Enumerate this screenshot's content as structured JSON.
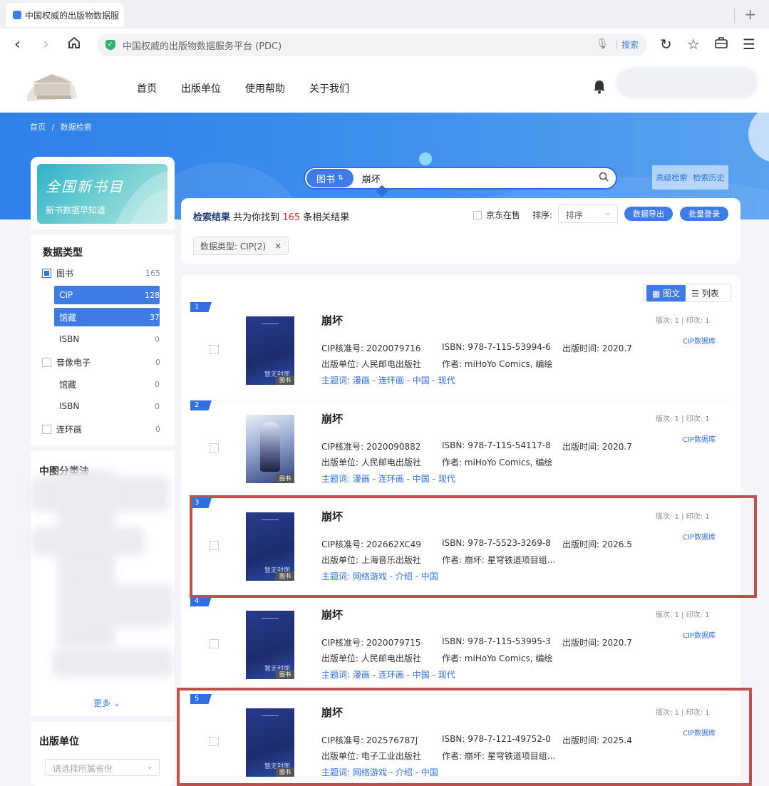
{
  "browser": {
    "tab_title": "中国权威的出版物数据服",
    "address_text": "中国权威的出版物数据服务平台 (PDC)",
    "search_label": "搜索",
    "new_tab": "+"
  },
  "site": {
    "nav": [
      "首页",
      "出版单位",
      "使用帮助",
      "关于我们"
    ]
  },
  "breadcrumb": [
    "首页",
    "/",
    "数据检索"
  ],
  "promo": {
    "title": "全国新书目",
    "subtitle": "新书数据早知道"
  },
  "facets": {
    "title": "数据类型",
    "items": [
      {
        "label": "图书",
        "count": "165"
      },
      {
        "label": "CIP",
        "count": "128"
      },
      {
        "label": "馆藏",
        "count": "37"
      },
      {
        "label": "ISBN",
        "count": "0"
      },
      {
        "label": "音像电子",
        "count": "0"
      },
      {
        "label": "馆藏",
        "count": "0"
      },
      {
        "label": "ISBN",
        "count": "0"
      },
      {
        "label": "连环画",
        "count": "0"
      }
    ],
    "classification_title": "中图分类法",
    "more": "更多",
    "publisher_title": "出版单位",
    "province_placeholder": "请选择所属省份"
  },
  "search": {
    "type": "图书",
    "type_arrow": "⇅",
    "query": "崩坏",
    "advanced": "高级检索",
    "history": "检索历史"
  },
  "results": {
    "title": "检索结果",
    "found_prefix": "共为你找到",
    "found_count": "165",
    "found_suffix": "条相关结果",
    "jd_label": "京东在售",
    "sort_label": "排序:",
    "sort_value": "排序",
    "export_btn": "数据导出",
    "batch_btn": "批量登录",
    "filter_chip": "数据类型: CIP(2)",
    "filter_chip_close": "×",
    "view_grid": "图文",
    "view_list": "列表"
  },
  "labels": {
    "cip": "CIP核准号:",
    "isbn": "ISBN:",
    "pubtime": "出版时间:",
    "publisher": "出版单位:",
    "author": "作者:",
    "keywords": "主题词:",
    "edition": "版次: 1 | 印次: 1",
    "db": "CIP数据库",
    "cover_badge": "图书",
    "cover_pending": "暂无封面"
  },
  "items": [
    {
      "idx": "1",
      "title": "崩坏",
      "cip": "2020079716",
      "isbn": "978-7-115-53994-6",
      "pubtime": "2020.7",
      "publisher": "人民邮电出版社",
      "author": "miHoYo Comics, 编绘",
      "keywords": "漫画 - 连环画 - 中国 - 现代"
    },
    {
      "idx": "2",
      "title": "崩坏",
      "cip": "2020090882",
      "isbn": "978-7-115-54117-8",
      "pubtime": "2020.7",
      "publisher": "人民邮电出版社",
      "author": "miHoYo Comics, 编绘",
      "keywords": "漫画 - 连环画 - 中国 - 现代"
    },
    {
      "idx": "3",
      "title": "崩坏",
      "cip": "202662XC49",
      "isbn": "978-7-5523-3269-8",
      "pubtime": "2026.5",
      "publisher": "上海音乐出版社",
      "author": "崩坏: 星穹铁道项目组…",
      "keywords": "网络游戏 - 介绍 - 中国"
    },
    {
      "idx": "4",
      "title": "崩坏",
      "cip": "2020079715",
      "isbn": "978-7-115-53995-3",
      "pubtime": "2020.7",
      "publisher": "人民邮电出版社",
      "author": "miHoYo Comics, 编绘",
      "keywords": "漫画 - 连环画 - 中国 - 现代"
    },
    {
      "idx": "5",
      "title": "崩坏",
      "cip": "202576787J",
      "isbn": "978-7-121-49752-0",
      "pubtime": "2025.4",
      "publisher": "电子工业出版社",
      "author": "崩坏: 星穹铁道项目组…",
      "keywords": "网络游戏 - 介绍 - 中国"
    }
  ],
  "colors": {
    "accent": "#3e7be4",
    "highlight": "#c0504d",
    "count_red": "#e03030"
  }
}
